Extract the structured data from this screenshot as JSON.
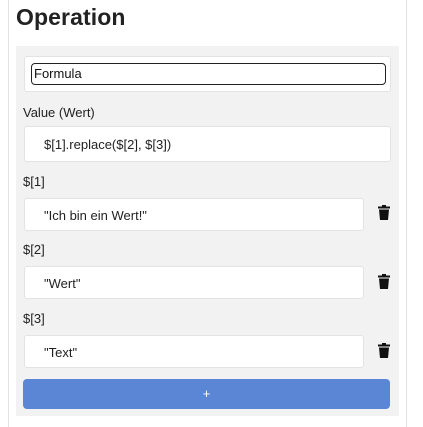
{
  "header": {
    "title": "Operation"
  },
  "operation": {
    "type_selected": "Formula",
    "value_label": "Value (Wert)",
    "value": "$[1].replace($[2], $[3])"
  },
  "params": [
    {
      "label": "$[1]",
      "value": "\"Ich bin ein Wert!\"",
      "delete_icon": "trash-icon"
    },
    {
      "label": "$[2]",
      "value": "\"Wert\"",
      "delete_icon": "trash-icon"
    },
    {
      "label": "$[3]",
      "value": "\"Text\"",
      "delete_icon": "trash-icon"
    }
  ],
  "add_button": {
    "label": "+"
  },
  "colors": {
    "accent": "#5b86d6",
    "panel_bg": "#f2f2f2"
  }
}
